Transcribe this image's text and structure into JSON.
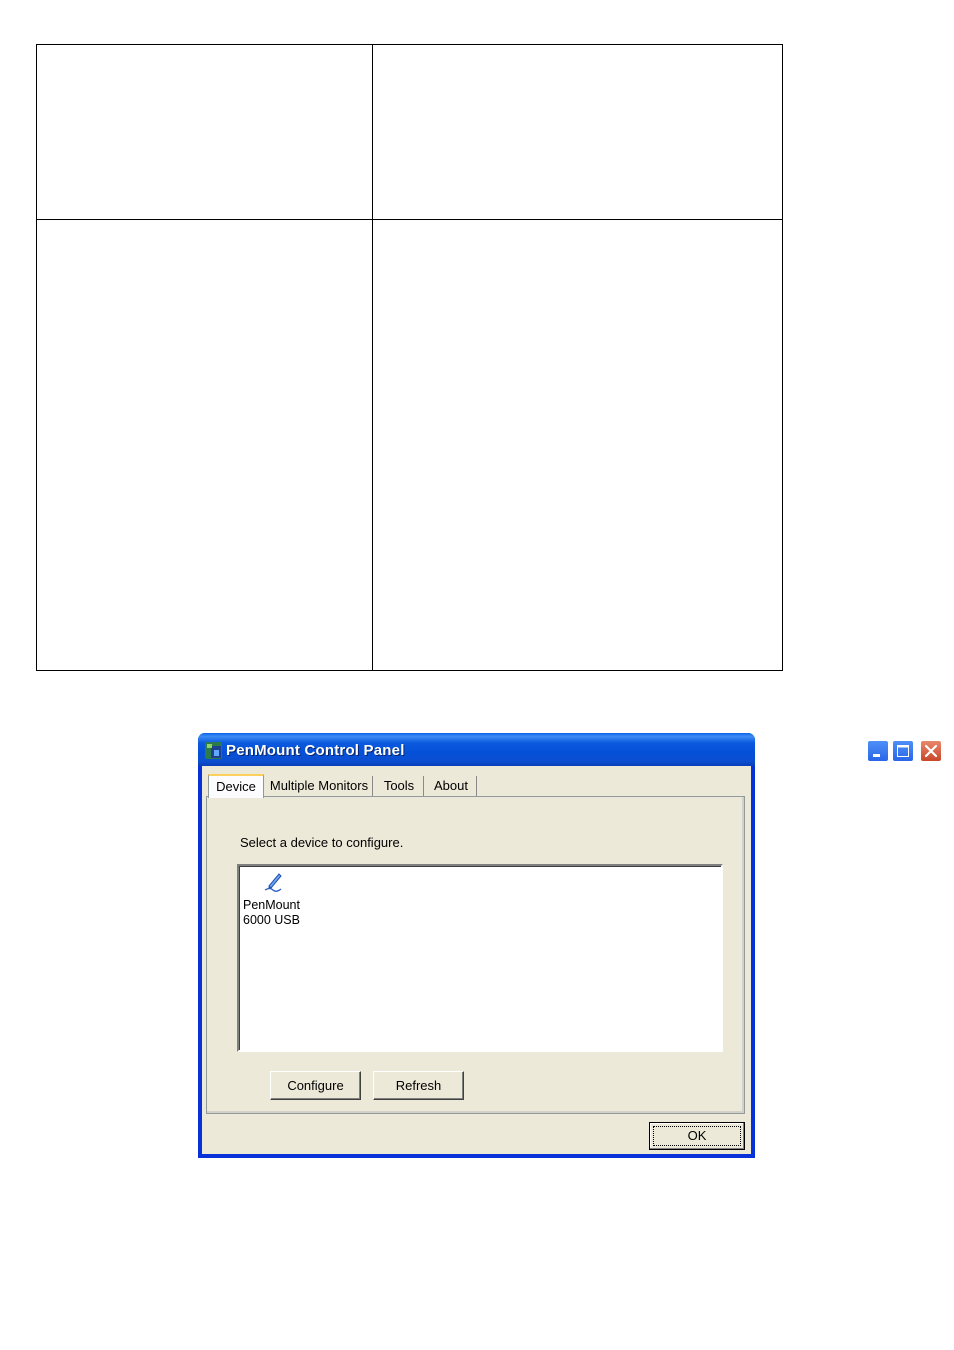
{
  "window": {
    "title": "PenMount Control Panel",
    "icon": "penmount-app-icon"
  },
  "titlebar_buttons": {
    "minimize_icon": "minimize-icon",
    "maximize_icon": "maximize-icon",
    "close_icon": "close-icon"
  },
  "tabs": [
    {
      "label": "Device",
      "selected": true
    },
    {
      "label": "Multiple Monitors",
      "selected": false
    },
    {
      "label": "Tools",
      "selected": false
    },
    {
      "label": "About",
      "selected": false
    }
  ],
  "device_tab": {
    "prompt": "Select a device to configure.",
    "devices": [
      {
        "line1": "PenMount",
        "line2": "6000 USB",
        "icon": "pen-device-icon"
      }
    ],
    "configure_label": "Configure",
    "refresh_label": "Refresh"
  },
  "footer": {
    "ok_label": "OK"
  },
  "colors": {
    "titlebar_blue": "#0550d8",
    "dialog_face": "#ece9d8",
    "close_red": "#c9462a",
    "active_tab_highlight": "#fdcf5b"
  }
}
